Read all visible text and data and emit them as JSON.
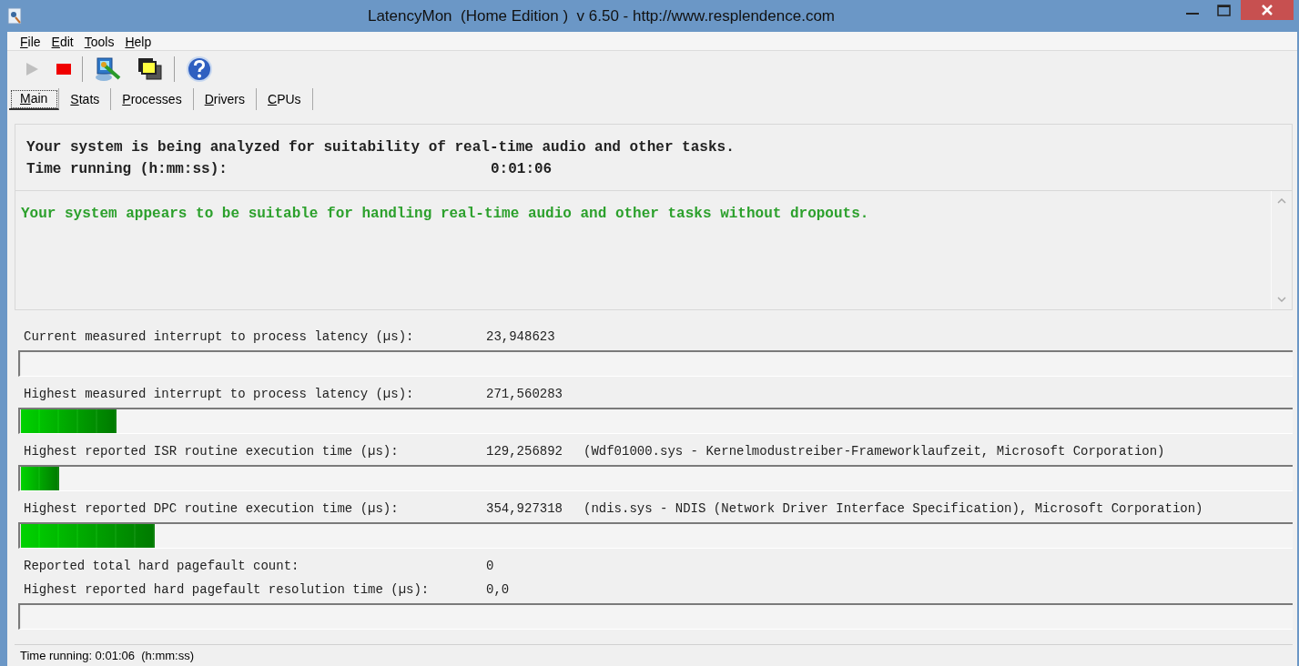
{
  "window": {
    "title": "LatencyMon  (Home Edition )  v 6.50 - http://www.resplendence.com"
  },
  "menu": [
    "File",
    "Edit",
    "Tools",
    "Help"
  ],
  "toolbar": [
    {
      "kind": "play",
      "disabled": true
    },
    {
      "kind": "stop",
      "disabled": false
    },
    {
      "kind": "separator"
    },
    {
      "kind": "monitor",
      "disabled": false
    },
    {
      "kind": "windows",
      "disabled": false
    },
    {
      "kind": "separator"
    },
    {
      "kind": "help",
      "disabled": false
    }
  ],
  "tabs": [
    {
      "label": "Main",
      "selected": true
    },
    {
      "label": "Stats",
      "selected": false
    },
    {
      "label": "Processes",
      "selected": false
    },
    {
      "label": "Drivers",
      "selected": false
    },
    {
      "label": "CPUs",
      "selected": false
    }
  ],
  "analysis": {
    "message": "Your system is being analyzed for suitability of real-time audio and other tasks.",
    "time_label": "Time running (h:mm:ss):",
    "time_value": "0:01:06"
  },
  "verdict": {
    "text": "Your system appears to be suitable for handling real-time audio and other tasks without dropouts.",
    "color": "#2ca02c"
  },
  "metrics": [
    {
      "label": "Current measured interrupt to process latency (µs):",
      "value": "23,948623",
      "meter": {
        "level": 0
      }
    },
    {
      "label": "Highest measured interrupt to process latency (µs):",
      "value": "271,560283",
      "meter": {
        "level": 0.075
      }
    },
    {
      "label": "Highest reported ISR routine execution time (µs):",
      "value": "129,256892",
      "detail": "(Wdf01000.sys - Kernelmodustreiber-Frameworklaufzeit, Microsoft Corporation)",
      "meter": {
        "level": 0.03
      }
    },
    {
      "label": "Highest reported DPC routine execution time (µs):",
      "value": "354,927318",
      "detail": "(ndis.sys - NDIS (Network Driver Interface Specification), Microsoft Corporation)",
      "meter": {
        "level": 0.105
      }
    },
    {
      "label": "Reported total hard pagefault count:",
      "value": "0"
    },
    {
      "label": "Highest reported hard pagefault resolution time (µs):",
      "value": "0,0",
      "meter": {
        "level": 0
      }
    }
  ],
  "status_bar": "Time running: 0:01:06  (h:mm:ss)"
}
